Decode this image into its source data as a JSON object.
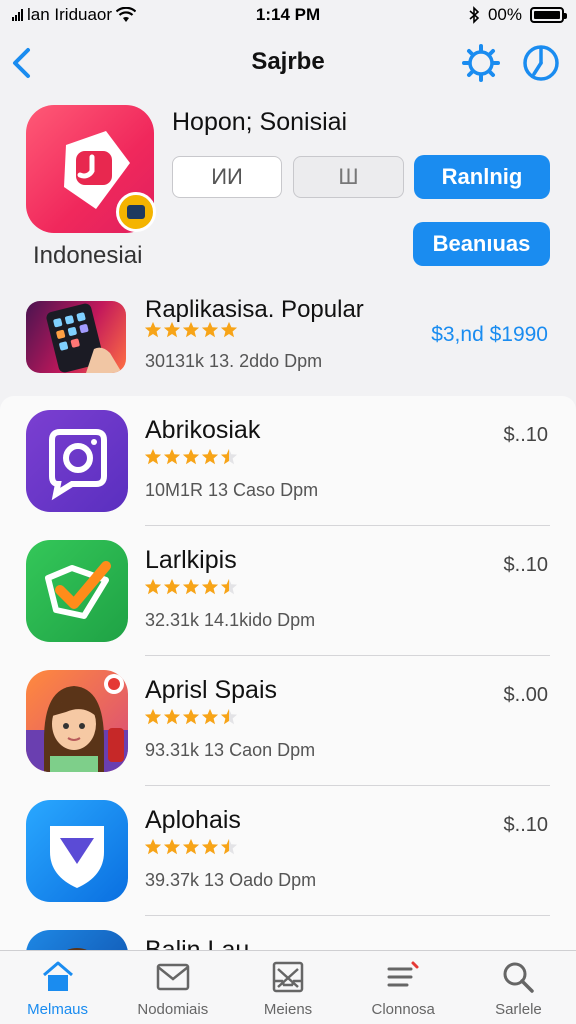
{
  "status_bar": {
    "carrier": "lan Iriduaor",
    "time": "1:14 PM",
    "battery": "00%"
  },
  "nav": {
    "title": "Sajrbe"
  },
  "featured": {
    "title": "Hopon; Sonisiai",
    "caption": "Indonesiai",
    "segment_1": "ИИ",
    "segment_2": "Ш",
    "ranking_button": "Ranlnig",
    "more_button": "Beanıuas"
  },
  "popular": {
    "title": "Raplikasisa. Popular",
    "meta": "30131k  13. 2ddo Dpm",
    "price": "$3,nd $1990",
    "rating": 5
  },
  "apps": [
    {
      "name": "Abrikosiak",
      "meta": "10M1R  13 Caso Dpm",
      "price": "$..10",
      "rating": 4.5,
      "icon": "camera-icon"
    },
    {
      "name": "Larlkipis",
      "meta": "32.31k  14.1kido Dpm",
      "price": "$..10",
      "rating": 4.5,
      "icon": "checkmark-icon"
    },
    {
      "name": "Aprisl Spais",
      "meta": "93.31k  13 Caon Dpm",
      "price": "$..00",
      "rating": 4.5,
      "icon": "avatar-icon"
    },
    {
      "name": "Aplohais",
      "meta": "39.37k  13 Oado Dpm",
      "price": "$..10",
      "rating": 4.5,
      "icon": "shield-icon"
    },
    {
      "name": "Balin Lau",
      "meta": "",
      "price": "",
      "rating": 0,
      "icon": "portrait-icon"
    }
  ],
  "tabs": [
    {
      "label": "Melmaus",
      "icon": "home-icon",
      "active": true
    },
    {
      "label": "Nodomiais",
      "icon": "mail-icon",
      "active": false
    },
    {
      "label": "Meiens",
      "icon": "inbox-icon",
      "active": false
    },
    {
      "label": "Clonnosa",
      "icon": "list-icon",
      "active": false
    },
    {
      "label": "Sarlele",
      "icon": "search-icon",
      "active": false
    }
  ],
  "colors": {
    "accent": "#1a8cf0",
    "star": "#f7a418",
    "featured_icon": "#f0285c"
  }
}
